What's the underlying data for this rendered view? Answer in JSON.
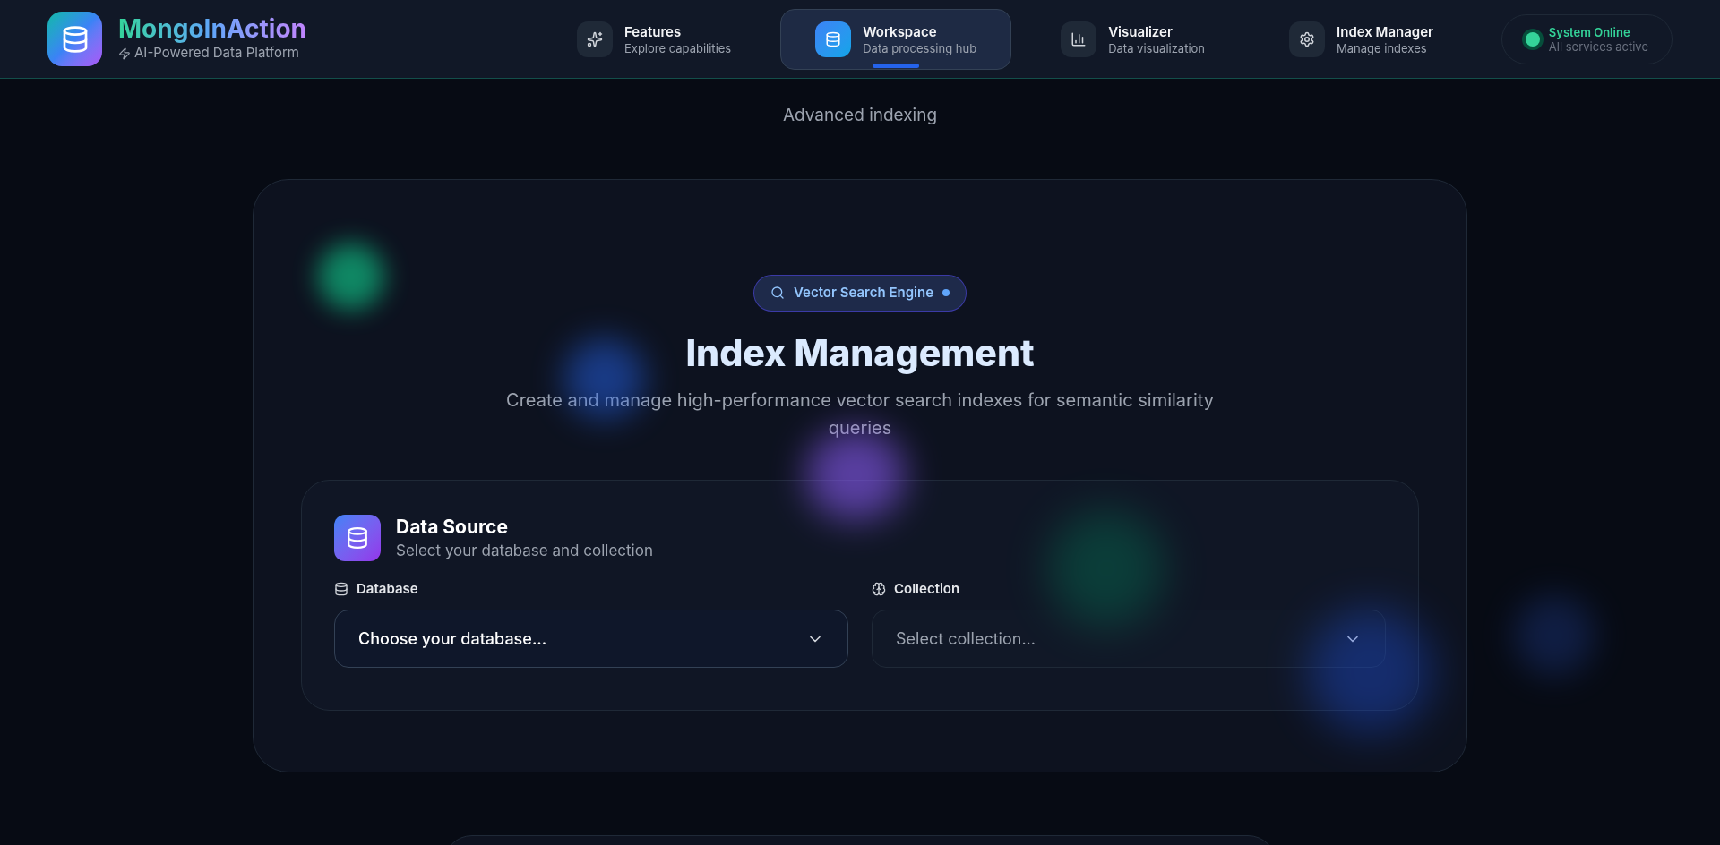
{
  "brand": {
    "name": "MongoInAction",
    "tagline": "AI-Powered Data Platform"
  },
  "nav": [
    {
      "kind": "sparkles",
      "label": "Features",
      "sublabel": "Explore capabilities",
      "selected": false
    },
    {
      "kind": "database",
      "label": "Workspace",
      "sublabel": "Data processing hub",
      "selected": true
    },
    {
      "kind": "chart",
      "label": "Visualizer",
      "sublabel": "Data visualization",
      "selected": false
    },
    {
      "kind": "gear",
      "label": "Index Manager",
      "sublabel": "Manage indexes",
      "selected": false
    }
  ],
  "status": {
    "label": "System Online",
    "detail": "All services active",
    "online": true
  },
  "hero": {
    "subtitle": "Advanced indexing"
  },
  "main": {
    "badge": "Vector Search Engine",
    "title": "Index Management",
    "description": "Create and manage high-performance vector search indexes for semantic similarity queries"
  },
  "data_source": {
    "title": "Data Source",
    "subtitle": "Select your database and collection",
    "fields": [
      {
        "kind": "database",
        "label": "Database",
        "value": "Choose your database...",
        "disabled": false
      },
      {
        "kind": "brain",
        "label": "Collection",
        "value": "Select collection...",
        "disabled": true
      }
    ]
  }
}
